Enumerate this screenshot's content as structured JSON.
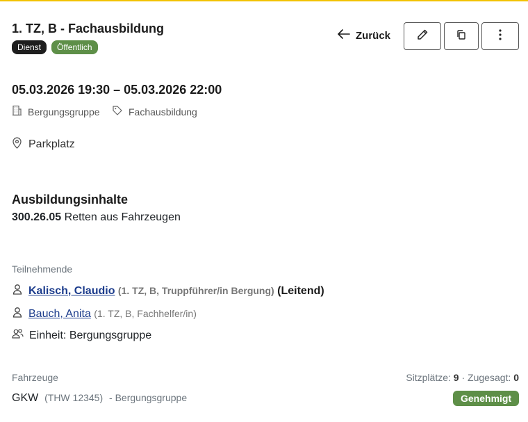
{
  "event": {
    "title": "1. TZ, B - Fachausbildung",
    "badges": [
      "Dienst",
      "Öffentlich"
    ],
    "date_range": "05.03.2026 19:30 – 05.03.2026 22:00",
    "unit": "Bergungsgruppe",
    "category": "Fachausbildung",
    "location": "Parkplatz"
  },
  "actions": {
    "back_label": "Zurück"
  },
  "training": {
    "heading": "Ausbildungsinhalte",
    "items": [
      {
        "code": "300.26.05",
        "text": "Retten aus Fahrzeugen"
      }
    ]
  },
  "participants": {
    "label": "Teilnehmende",
    "people": [
      {
        "name": "Kalisch, Claudio",
        "detail": "(1. TZ, B, Truppführer/in Bergung)",
        "role": "(Leitend)"
      },
      {
        "name": "Bauch, Anita",
        "detail": "(1. TZ, B, Fachhelfer/in)",
        "role": ""
      }
    ],
    "unit_line": "Einheit: Bergungsgruppe"
  },
  "vehicles": {
    "label": "Fahrzeuge",
    "seats_label": "Sitzplätze:",
    "seats_value": "9",
    "separator": "·",
    "confirmed_label": "Zugesagt:",
    "confirmed_value": "0",
    "items": [
      {
        "name": "GKW",
        "plate": "(THW 12345)",
        "unit": "- Bergungsgruppe",
        "status": "Genehmigt",
        "status_color": "#5e8f48"
      }
    ]
  },
  "colors": {
    "accent_bar": "#f2c200",
    "badge_dark": "#1e1e1e",
    "badge_green": "#5e8f48",
    "link": "#1c3c8c"
  },
  "icons": [
    "arrow-left-icon",
    "pencil-icon",
    "copy-icon",
    "more-vertical-icon",
    "building-icon",
    "tag-icon",
    "map-pin-icon",
    "person-icon",
    "people-icon"
  ]
}
